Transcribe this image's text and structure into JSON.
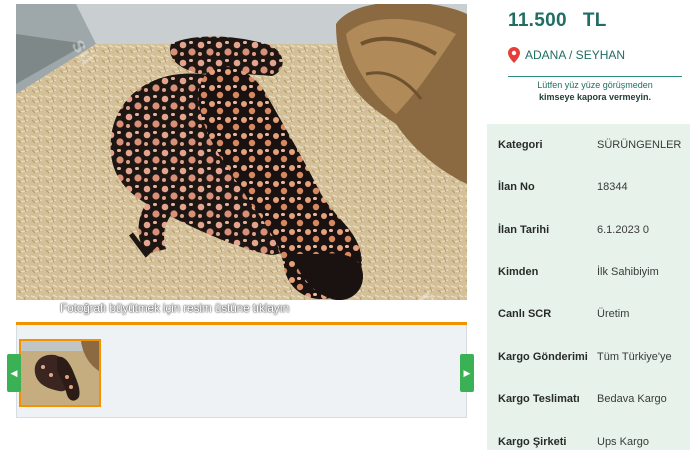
{
  "gallery": {
    "caption": "Fotoğrafı büyütmek için resim üstüne tıklayın",
    "main_photo_subject": "gila monster lizard on wood shavings",
    "nav_prev_icon": "chevron-left-icon",
    "nav_next_icon": "chevron-right-icon"
  },
  "listing": {
    "price_value": "11.500",
    "price_currency": "TL",
    "location": "ADANA / SEYHAN",
    "warning_line1": "Lütfen yüz yüze görüşmeden",
    "warning_line2": "kimseye kapora vermeyin."
  },
  "details": [
    {
      "label": "Kategori",
      "value": "SÜRÜNGENLER"
    },
    {
      "label": "İlan No",
      "value": "18344"
    },
    {
      "label": "İlan Tarihi",
      "value": "6.1.2023 0"
    },
    {
      "label": "Kimden",
      "value": "İlk Sahibiyim"
    },
    {
      "label": "Canlı SCR",
      "value": "Üretim"
    },
    {
      "label": "Kargo Gönderimi",
      "value": "Tüm Türkiye'ye"
    },
    {
      "label": "Kargo Teslimatı",
      "value": "Bedava Kargo"
    },
    {
      "label": "Kargo Şirketi",
      "value": "Ups Kargo"
    }
  ],
  "colors": {
    "accent_green": "#3ab155",
    "price_teal": "#1f6d63",
    "orange": "#f39200",
    "detail_bg": "#e7f3ea",
    "pin_red": "#e3403a"
  }
}
